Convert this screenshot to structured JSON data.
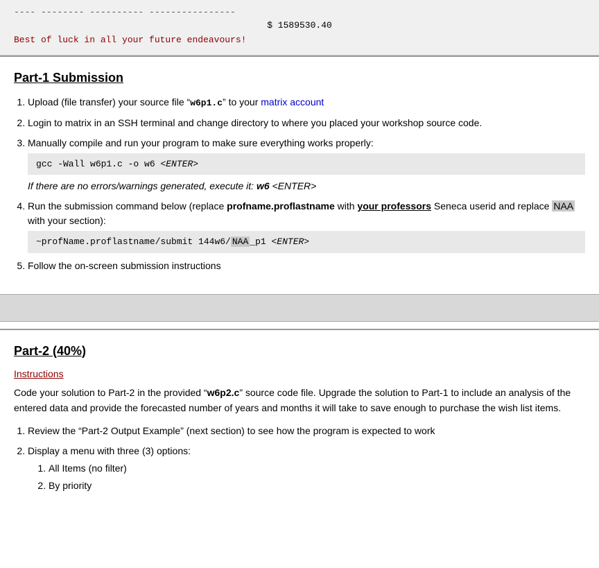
{
  "top_block": {
    "dashes": "---- -------- ---------- ----------------",
    "amount": "$ 1589530.40",
    "farewell": "Best of luck in all your future endeavours!"
  },
  "part1": {
    "title": "Part-1 Submission",
    "steps": [
      {
        "text_before": "Upload (file transfer) your source file “",
        "code": "w6p1.c",
        "text_after": "” to your matrix account"
      },
      {
        "text": "Login to matrix in an SSH terminal and change directory to where you placed your workshop source code."
      },
      {
        "text_before": "Manually compile and run your program to make sure everything works properly:",
        "code_block": "gcc -Wall w6p1.c -o w6 <ENTER>",
        "italic": "If there are no errors/warnings generated, execute it: w6  <ENTER>"
      },
      {
        "text_before": "Run the submission command below (replace ",
        "bold_text": "profname.proflastname",
        "text_middle": " with ",
        "underline_bold": "your professors",
        "text_after_ub": " Seneca userid and replace ",
        "highlight_text": "NAA",
        "text_after_highlight": " with your section):",
        "code_block": "~profName.proflastname/submit 144w6/NAA_p1 <ENTER>"
      },
      {
        "text": "Follow the on-screen submission instructions"
      }
    ]
  },
  "part2": {
    "title": "Part-2 (40%)",
    "instructions_label": "Instructions",
    "intro_text": "Code your solution to Part-2 in the provided “w6p2.c” source code file. Upgrade the solution to Part-1 to include an analysis of the entered data and provide the forecasted number of years and months it will take to save enough to purchase the wish list items.",
    "steps": [
      {
        "text": "Review the “Part-2 Output Example” (next section) to see how the program is expected to work"
      },
      {
        "text": "Display a menu with three (3) options:",
        "sub_items": [
          "All Items (no filter)",
          "By priority"
        ]
      }
    ]
  }
}
